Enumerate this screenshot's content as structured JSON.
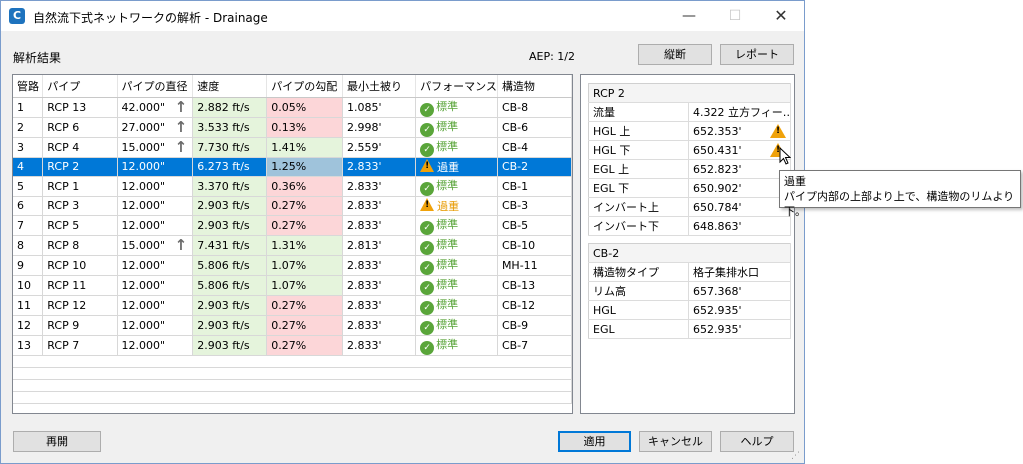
{
  "window": {
    "app_icon": "C",
    "title": "自然流下式ネットワークの解析 - Drainage",
    "minimize": "—",
    "maximize": "☐",
    "close": "✕"
  },
  "header": {
    "section_label": "解析結果",
    "aep": "AEP: 1/2",
    "profile_button": "縦断",
    "report_button": "レポート"
  },
  "grid": {
    "columns": [
      "管路",
      "パイプ",
      "パイプの直径",
      "速度",
      "パイプの勾配",
      "最小土被り",
      "パフォーマンス",
      "構造物"
    ],
    "rows": [
      {
        "no": "1",
        "pipe": "RCP 13",
        "dia": "42.000\"",
        "up": true,
        "vel": "2.882 ft/s",
        "slope": "0.05%",
        "slope_bad": true,
        "cover": "1.085'",
        "perf": "標準",
        "perf_warn": false,
        "struct": "CB-8"
      },
      {
        "no": "2",
        "pipe": "RCP 6",
        "dia": "27.000\"",
        "up": true,
        "vel": "3.533 ft/s",
        "slope": "0.13%",
        "slope_bad": true,
        "cover": "2.998'",
        "perf": "標準",
        "perf_warn": false,
        "struct": "CB-6"
      },
      {
        "no": "3",
        "pipe": "RCP 4",
        "dia": "15.000\"",
        "up": true,
        "vel": "7.730 ft/s",
        "slope": "1.41%",
        "slope_bad": false,
        "cover": "2.559'",
        "perf": "標準",
        "perf_warn": false,
        "struct": "CB-4"
      },
      {
        "no": "4",
        "pipe": "RCP 2",
        "dia": "12.000\"",
        "up": false,
        "vel": "6.273 ft/s",
        "slope": "1.25%",
        "slope_bad": true,
        "cover": "2.833'",
        "perf": "過重",
        "perf_warn": true,
        "struct": "CB-2",
        "selected": true
      },
      {
        "no": "5",
        "pipe": "RCP 1",
        "dia": "12.000\"",
        "up": false,
        "vel": "3.370 ft/s",
        "slope": "0.36%",
        "slope_bad": true,
        "cover": "2.833'",
        "perf": "標準",
        "perf_warn": false,
        "struct": "CB-1"
      },
      {
        "no": "6",
        "pipe": "RCP 3",
        "dia": "12.000\"",
        "up": false,
        "vel": "2.903 ft/s",
        "slope": "0.27%",
        "slope_bad": true,
        "cover": "2.833'",
        "perf": "過重",
        "perf_warn": true,
        "struct": "CB-3"
      },
      {
        "no": "7",
        "pipe": "RCP 5",
        "dia": "12.000\"",
        "up": false,
        "vel": "2.903 ft/s",
        "slope": "0.27%",
        "slope_bad": true,
        "cover": "2.833'",
        "perf": "標準",
        "perf_warn": false,
        "struct": "CB-5"
      },
      {
        "no": "8",
        "pipe": "RCP 8",
        "dia": "15.000\"",
        "up": true,
        "vel": "7.431 ft/s",
        "slope": "1.31%",
        "slope_bad": false,
        "cover": "2.813'",
        "perf": "標準",
        "perf_warn": false,
        "struct": "CB-10"
      },
      {
        "no": "9",
        "pipe": "RCP 10",
        "dia": "12.000\"",
        "up": false,
        "vel": "5.806 ft/s",
        "slope": "1.07%",
        "slope_bad": false,
        "cover": "2.833'",
        "perf": "標準",
        "perf_warn": false,
        "struct": "MH-11"
      },
      {
        "no": "10",
        "pipe": "RCP 11",
        "dia": "12.000\"",
        "up": false,
        "vel": "5.806 ft/s",
        "slope": "1.07%",
        "slope_bad": false,
        "cover": "2.833'",
        "perf": "標準",
        "perf_warn": false,
        "struct": "CB-13"
      },
      {
        "no": "11",
        "pipe": "RCP 12",
        "dia": "12.000\"",
        "up": false,
        "vel": "2.903 ft/s",
        "slope": "0.27%",
        "slope_bad": true,
        "cover": "2.833'",
        "perf": "標準",
        "perf_warn": false,
        "struct": "CB-12"
      },
      {
        "no": "12",
        "pipe": "RCP 9",
        "dia": "12.000\"",
        "up": false,
        "vel": "2.903 ft/s",
        "slope": "0.27%",
        "slope_bad": true,
        "cover": "2.833'",
        "perf": "標準",
        "perf_warn": false,
        "struct": "CB-9"
      },
      {
        "no": "13",
        "pipe": "RCP 7",
        "dia": "12.000\"",
        "up": false,
        "vel": "2.903 ft/s",
        "slope": "0.27%",
        "slope_bad": true,
        "cover": "2.833'",
        "perf": "標準",
        "perf_warn": false,
        "struct": "CB-7"
      }
    ]
  },
  "pipe_props": {
    "title": "RCP 2",
    "rows": [
      {
        "label": "流量",
        "value": "4.322 立方フィー…",
        "warn": false
      },
      {
        "label": "HGL 上",
        "value": "652.353'",
        "warn": true
      },
      {
        "label": "HGL 下",
        "value": "650.431'",
        "warn": true
      },
      {
        "label": "EGL 上",
        "value": "652.823'",
        "warn": false
      },
      {
        "label": "EGL 下",
        "value": "650.902'",
        "warn": false
      },
      {
        "label": "インバート上",
        "value": "650.784'",
        "warn": false
      },
      {
        "label": "インバート下",
        "value": "648.863'",
        "warn": false
      }
    ]
  },
  "struct_props": {
    "title": "CB-2",
    "rows": [
      {
        "label": "構造物タイプ",
        "value": "格子集排水口"
      },
      {
        "label": "リム高",
        "value": "657.368'"
      },
      {
        "label": "HGL",
        "value": "652.935'"
      },
      {
        "label": "EGL",
        "value": "652.935'"
      }
    ]
  },
  "tooltip": {
    "title": "過重",
    "text": "パイプ内部の上部より上で、構造物のリムより下。"
  },
  "footer": {
    "reopen": "再開",
    "apply": "適用",
    "cancel": "キャンセル",
    "help": "ヘルプ"
  },
  "colors": {
    "selection": "#0078d7",
    "good_cell": "#e5f4dc",
    "bad_cell": "#fcd6d8",
    "ok_status": "#5aa53a",
    "warn_status": "#f0a20a"
  }
}
